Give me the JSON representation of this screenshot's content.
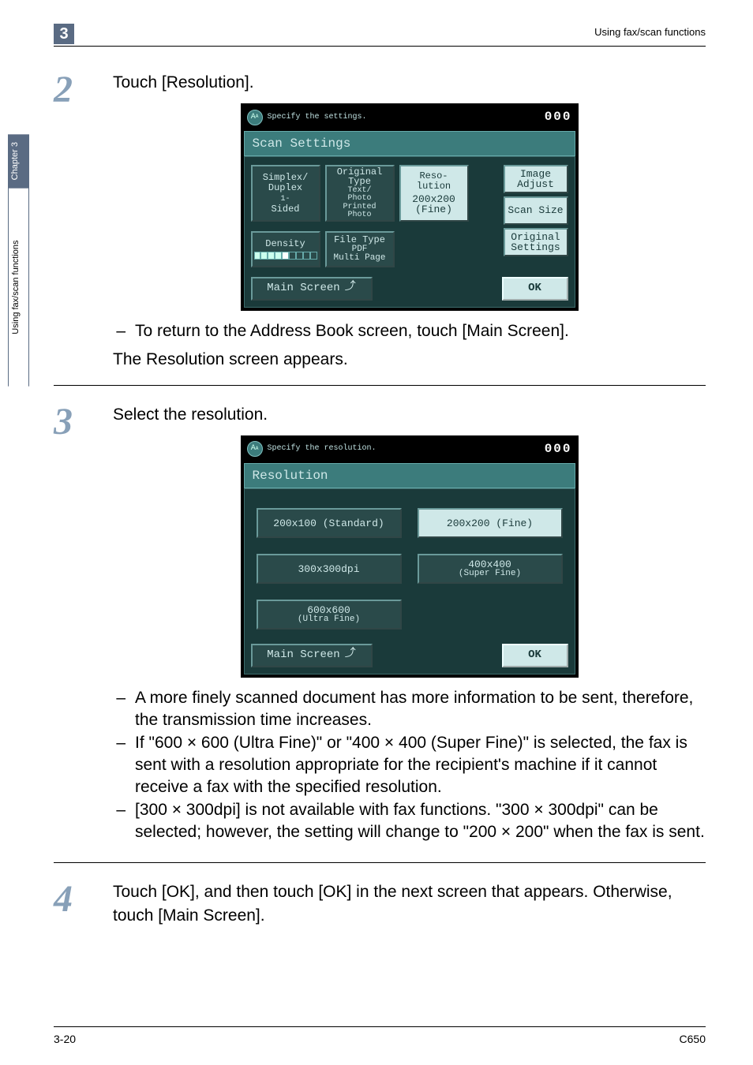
{
  "header": {
    "chapter_mark": "3",
    "right": "Using fax/scan functions"
  },
  "side_tab": {
    "cap": "Chapter 3",
    "body": "Using fax/scan functions"
  },
  "steps": {
    "s2": {
      "num": "2",
      "title": "Touch [Resolution].",
      "note1": "To return to the Address Book screen, touch [Main Screen].",
      "note2": "The Resolution screen appears."
    },
    "s3": {
      "num": "3",
      "title": "Select the resolution.",
      "note1": "A more finely scanned document has more information to be sent, therefore, the transmission time increases.",
      "note2": "If \"600 × 600 (Ultra Fine)\" or \"400 × 400 (Super Fine)\" is selected, the fax is sent with a resolution appropriate for the recipient's machine if it cannot receive a fax with the specified resolution.",
      "note3": "[300 × 300dpi] is not available with fax functions. \"300 × 300dpi\" can be selected; however, the setting will change to \"200 × 200\" when the fax is sent."
    },
    "s4": {
      "num": "4",
      "text": "Touch [OK], and then touch [OK] in the next screen that appears. Otherwise, touch [Main Screen]."
    }
  },
  "screen1": {
    "topbar_msg": "Specify the settings.",
    "counter": "000",
    "band": "Scan Settings",
    "btn_simplex_l1": "Simplex/",
    "btn_simplex_l2": "Duplex",
    "btn_simplex_l3": "1-",
    "btn_simplex_l4": "Sided",
    "btn_origtype_l1": "Original",
    "btn_origtype_l2": "Type",
    "btn_origtype_l3": "Text/",
    "btn_origtype_l4": "Photo",
    "btn_origtype_l5": "Printed",
    "btn_origtype_l6": "Photo",
    "btn_res_l1": "Reso-",
    "btn_res_l2": "lution",
    "btn_res_l3": "200x200",
    "btn_res_l4": "(Fine)",
    "btn_density": "Density",
    "btn_ftype_l1": "File Type",
    "btn_ftype_l2": "PDF",
    "btn_ftype_l3": "Multi Page",
    "side_imgadj": "Image Adjust",
    "side_scansize": "Scan Size",
    "side_origset": "Original Settings",
    "main_screen": "Main Screen",
    "ok": "OK"
  },
  "screen2": {
    "topbar_msg": "Specify the resolution.",
    "counter": "000",
    "band": "Resolution",
    "r1": "200x100 (Standard)",
    "r2": "200x200 (Fine)",
    "r3": "300x300dpi",
    "r4a": "400x400",
    "r4b": "(Super Fine)",
    "r5a": "600x600",
    "r5b": "(Ultra Fine)",
    "main_screen": "Main Screen",
    "ok": "OK"
  },
  "footer": {
    "left": "3-20",
    "right": "C650"
  }
}
